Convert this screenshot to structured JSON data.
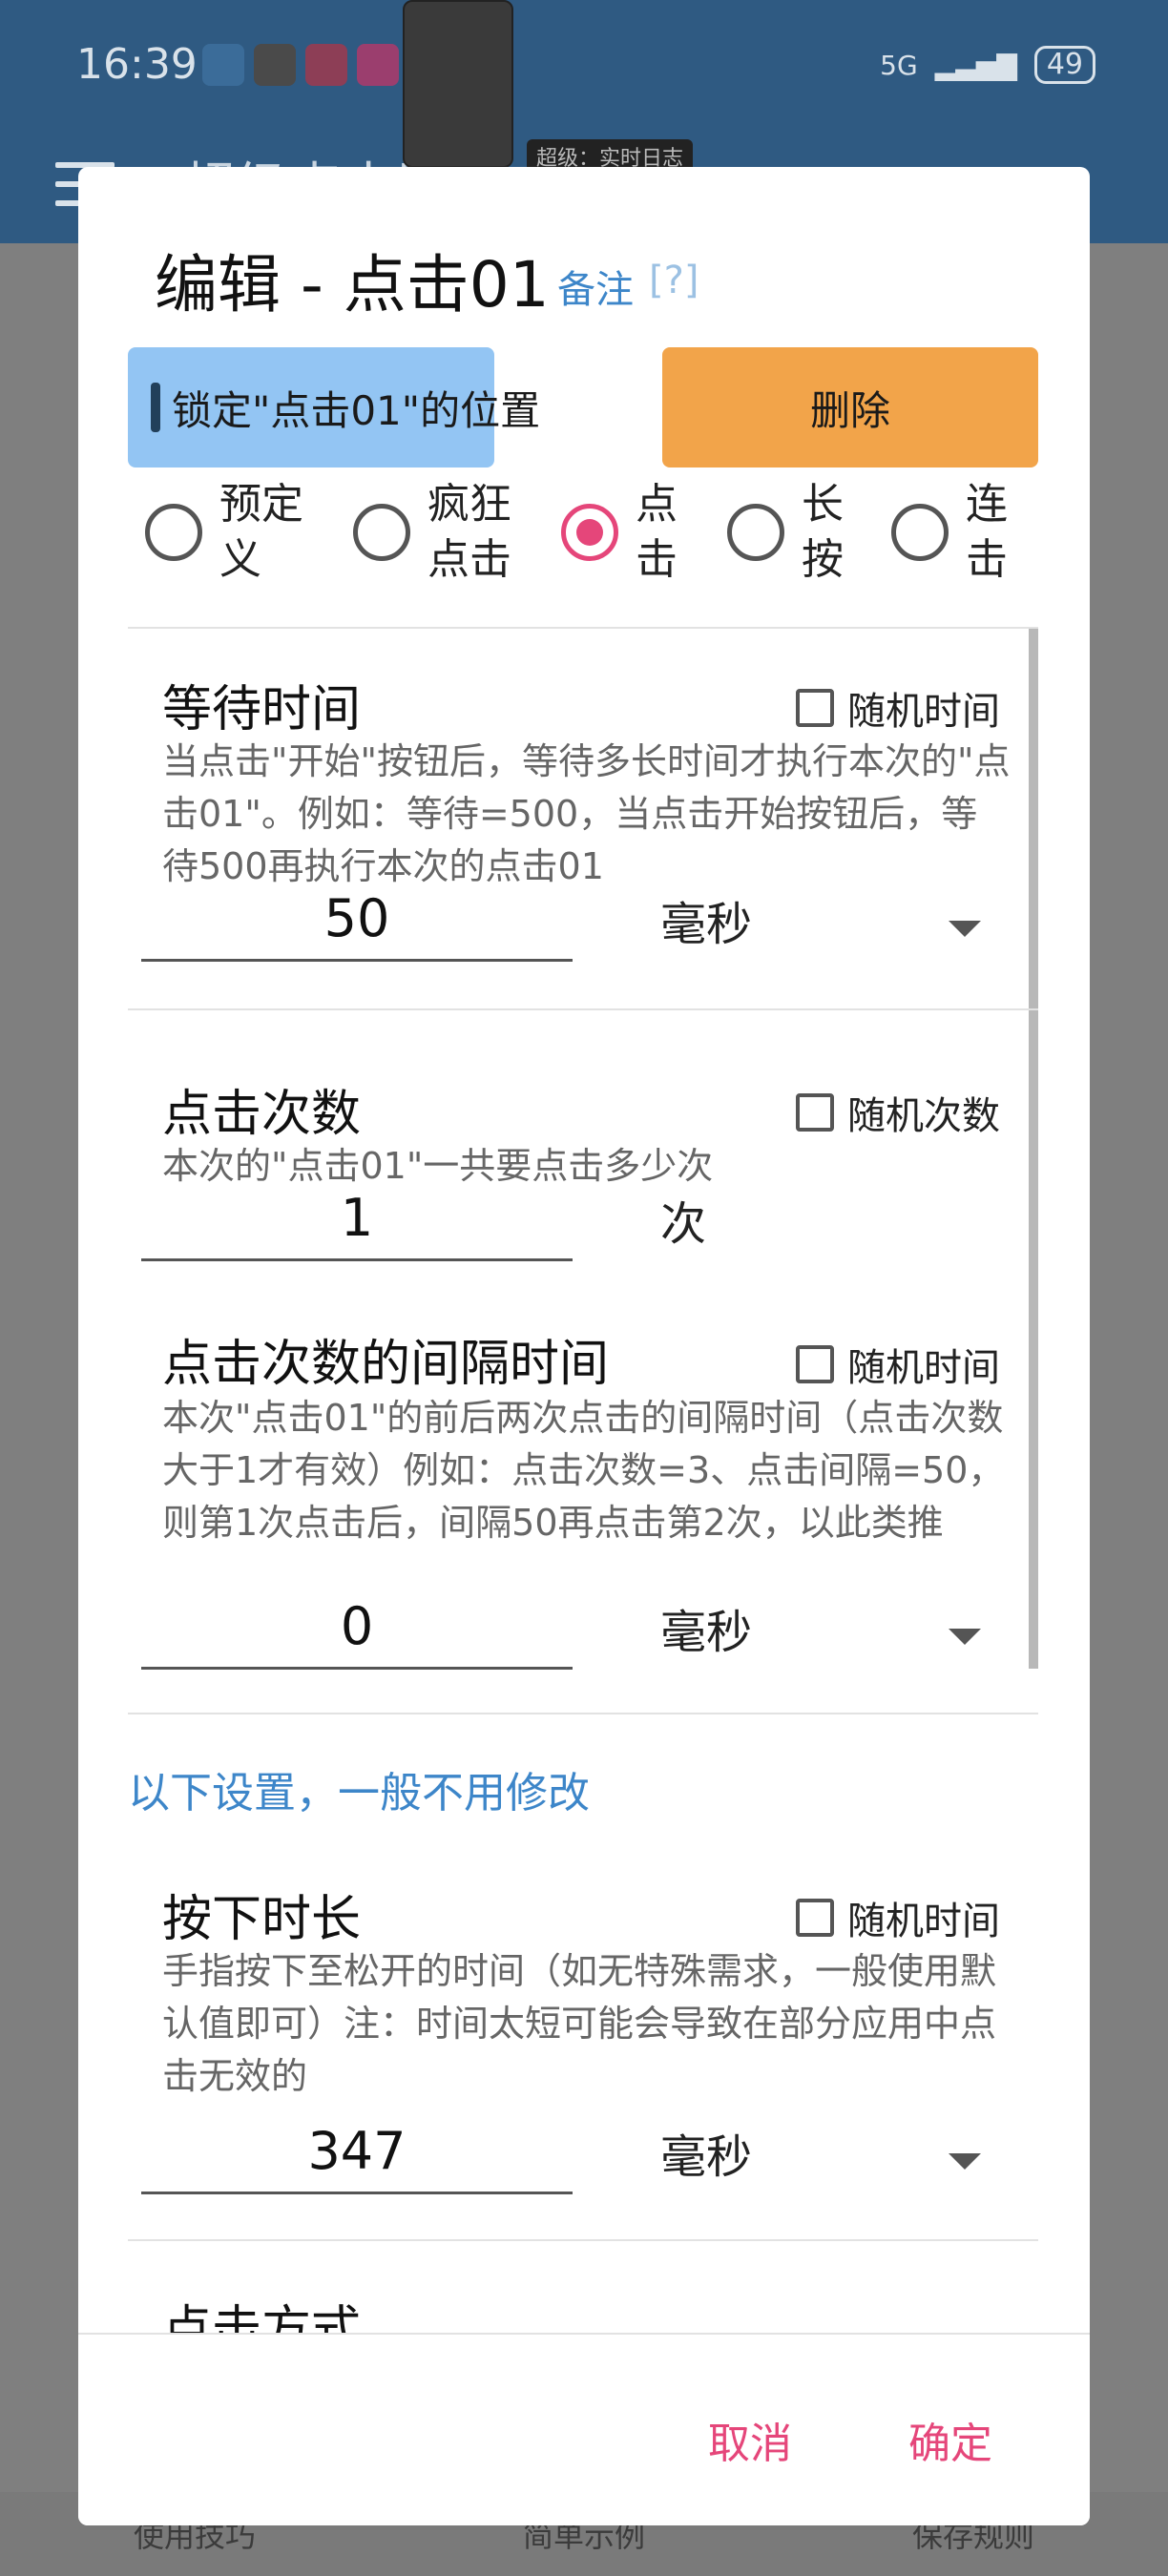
{
  "status_bar": {
    "time": "16:39",
    "network": "5G",
    "battery": "49"
  },
  "background": {
    "title": "超级点击器",
    "float_tag": "超级：实时日志",
    "bottom_tabs": [
      "使用技巧",
      "简单示例",
      "保存规则"
    ]
  },
  "dialog": {
    "title": "编辑 - 点击01",
    "note_link": "备注",
    "help_mark": "[?]",
    "lock_label": "锁定\"点击01\"的位置",
    "delete_label": "删除",
    "radio_options": [
      "预定义",
      "疯狂点击",
      "点击",
      "长按",
      "连击"
    ],
    "selected_radio": "点击",
    "wait": {
      "title": "等待时间",
      "random_label": "随机时间",
      "desc": "当点击\"开始\"按钮后，等待多长时间才执行本次的\"点击01\"。例如：等待=500，当点击开始按钮后，等待500再执行本次的点击01",
      "value": "50",
      "unit": "毫秒"
    },
    "count": {
      "title": "点击次数",
      "random_label": "随机次数",
      "desc": "本次的\"点击01\"一共要点击多少次",
      "value": "1",
      "unit": "次"
    },
    "interval": {
      "title": "点击次数的间隔时间",
      "random_label": "随机时间",
      "desc": "本次\"点击01\"的前后两次点击的间隔时间（点击次数大于1才有效）例如：点击次数=3、点击间隔=50，则第1次点击后，间隔50再点击第2次，以此类推",
      "value": "0",
      "unit": "毫秒"
    },
    "advanced_heading": "以下设置，一般不用修改",
    "press": {
      "title": "按下时长",
      "random_label": "随机时间",
      "desc": "手指按下至松开的时间（如无特殊需求，一般使用默认值即可）注：时间太短可能会导致在部分应用中点击无效的",
      "value": "347",
      "unit": "毫秒"
    },
    "next_section_partial": "点击方式",
    "cancel_label": "取消",
    "ok_label": "确定"
  }
}
